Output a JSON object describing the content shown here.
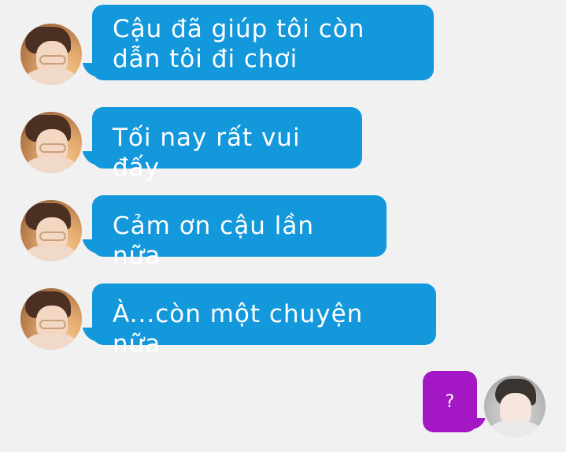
{
  "messages": [
    {
      "sender": "left",
      "text": "Cậu đã giúp tôi còn dẫn tôi đi chơi"
    },
    {
      "sender": "left",
      "text": "Tối nay rất vui đấy"
    },
    {
      "sender": "left",
      "text": "Cảm ơn cậu lần nữa"
    },
    {
      "sender": "left",
      "text": "À...còn một chuyện nữa"
    },
    {
      "sender": "right",
      "text": "?"
    }
  ],
  "colors": {
    "background": "#f1f1f1",
    "left_bubble": "#1398dc",
    "right_bubble": "#a317c5",
    "text": "#ffffff"
  }
}
